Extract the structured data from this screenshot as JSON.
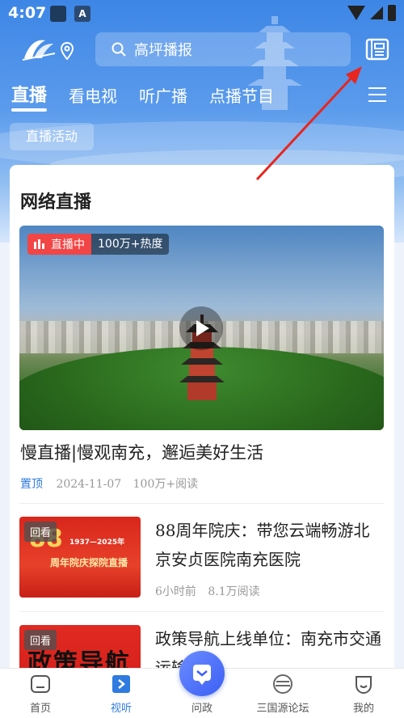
{
  "status": {
    "time": "4:07",
    "notif_badge": "A"
  },
  "header": {
    "search_placeholder": "高坪播报",
    "logo_icon": "app-logo-icon",
    "location_icon": "location-pin-icon",
    "news_icon": "newspaper-icon"
  },
  "tabs": [
    {
      "label": "直播",
      "active": true
    },
    {
      "label": "看电视",
      "active": false
    },
    {
      "label": "听广播",
      "active": false
    },
    {
      "label": "点播节目",
      "active": false
    }
  ],
  "subtab": {
    "label": "直播活动"
  },
  "section": {
    "title": "网络直播"
  },
  "featured": {
    "live_label": "直播中",
    "heat": "100万+热度",
    "title": "慢直播|慢观南充，邂逅美好生活",
    "tag": "置顶",
    "date": "2024-11-07",
    "reads": "100万+阅读"
  },
  "items": [
    {
      "badge": "回看",
      "thumb_number": "88",
      "thumb_years": "1937—2025年",
      "thumb_caption": "周年院庆探院直播",
      "title": "88周年院庆：带您云端畅游北京安贞医院南充医院",
      "time": "6小时前",
      "reads": "8.1万阅读"
    },
    {
      "badge": "回看",
      "thumb_caption": "政策导航",
      "title": "政策导航上线单位：南充市交通运输局"
    }
  ],
  "bottom_nav": [
    {
      "label": "首页",
      "icon": "home-icon",
      "active": false
    },
    {
      "label": "视听",
      "icon": "play-tv-icon",
      "active": true
    },
    {
      "label": "问政",
      "icon": "chat-bubble-icon",
      "active": false
    },
    {
      "label": "三国源论坛",
      "icon": "forum-logo-icon",
      "active": false
    },
    {
      "label": "我的",
      "icon": "profile-icon",
      "active": false
    }
  ],
  "colors": {
    "accent": "#2f7be0",
    "live_red": "#f24545",
    "header_blue": "#3d86e6",
    "arrow_red": "#e8261f"
  }
}
